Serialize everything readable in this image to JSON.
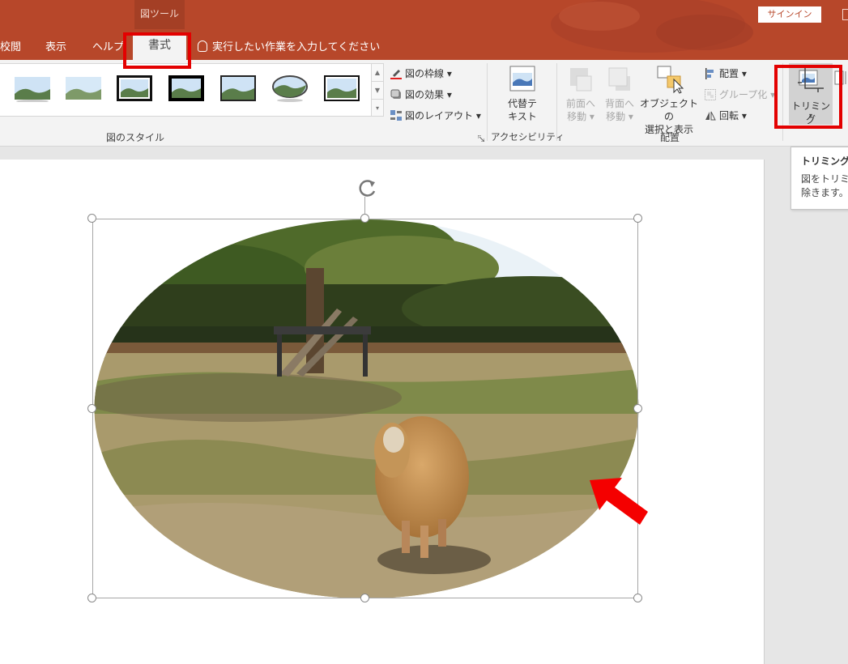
{
  "titlebar": {
    "context_group": "図ツール",
    "signin": "サインイン"
  },
  "tabs": [
    {
      "label": "校閲"
    },
    {
      "label": "表示"
    },
    {
      "label": "ヘルプ"
    },
    {
      "label": "書式"
    }
  ],
  "tell_me": "実行したい作業を入力してください",
  "ribbon": {
    "picture_styles": {
      "label": "図のスタイル",
      "border": "図の枠線",
      "effects": "図の効果",
      "layout": "図のレイアウト"
    },
    "accessibility": {
      "label": "アクセシビリティ",
      "alt_text_line1": "代替テ",
      "alt_text_line2": "キスト"
    },
    "arrange": {
      "label": "配置",
      "bring_forward_line1": "前面へ",
      "bring_forward_line2": "移動",
      "send_backward_line1": "背面へ",
      "send_backward_line2": "移動",
      "selection_pane_line1": "オブジェクトの",
      "selection_pane_line2": "選択と表示",
      "align": "配置",
      "group": "グループ化",
      "rotate": "回転"
    },
    "size": {
      "crop": "トリミング"
    }
  },
  "tooltip": {
    "title": "トリミング",
    "desc_line1": "図をトリミン",
    "desc_line2": "除きます。"
  },
  "colors": {
    "accent": "#b7472a",
    "highlight": "#e30000"
  }
}
